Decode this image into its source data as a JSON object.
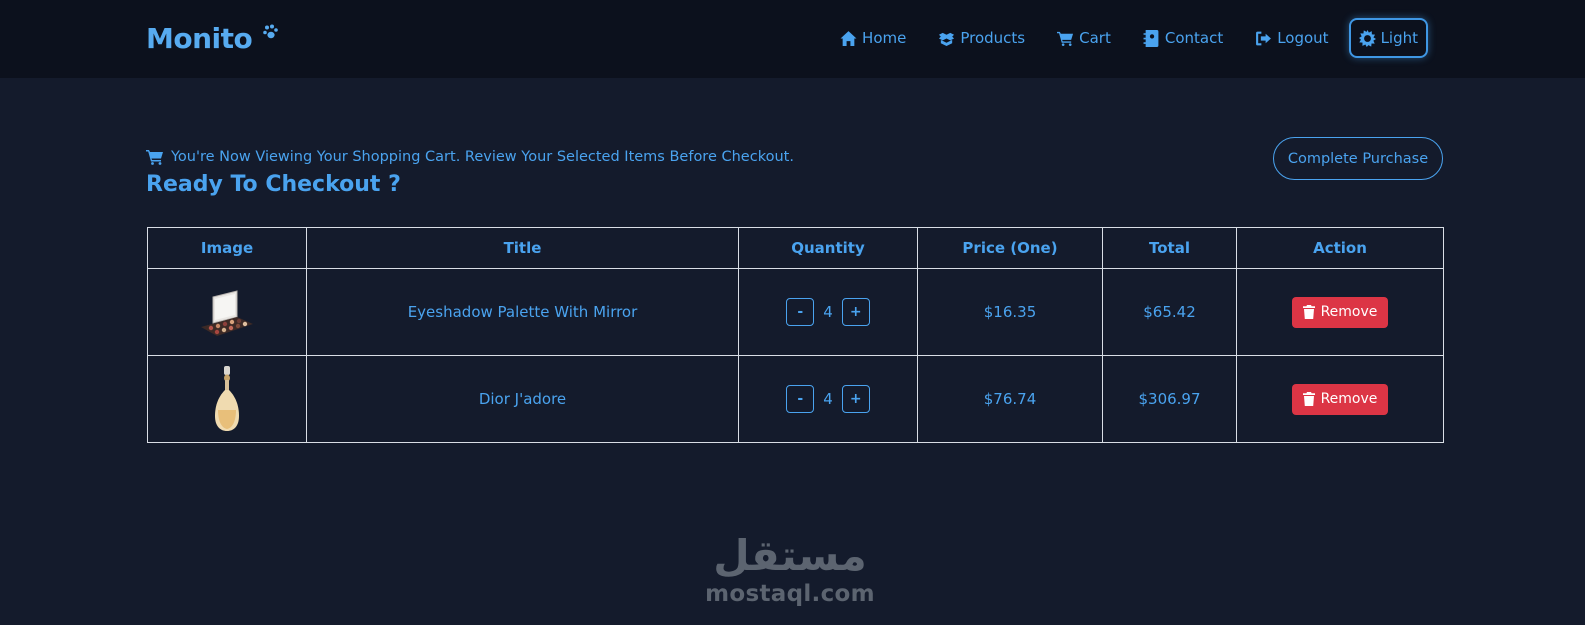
{
  "brand": {
    "name": "Monito"
  },
  "nav": {
    "items": [
      {
        "label": "Home",
        "icon": "home-icon"
      },
      {
        "label": "Products",
        "icon": "boxes-icon"
      },
      {
        "label": "Cart",
        "icon": "cart-icon"
      },
      {
        "label": "Contact",
        "icon": "address-book-icon"
      },
      {
        "label": "Logout",
        "icon": "logout-icon"
      },
      {
        "label": "Light",
        "icon": "sun-icon"
      }
    ]
  },
  "cart_header": {
    "note": "You're Now Viewing Your Shopping Cart. Review Your Selected Items Before Checkout.",
    "title": "Ready To Checkout ?",
    "complete_label": "Complete Purchase"
  },
  "table": {
    "headers": [
      "Image",
      "Title",
      "Quantity",
      "Price (One)",
      "Total",
      "Action"
    ],
    "rows": [
      {
        "image": "eyeshadow-palette-image",
        "title": "Eyeshadow Palette With Mirror",
        "quantity": "4",
        "price": "$16.35",
        "total": "$65.42",
        "action": "Remove"
      },
      {
        "image": "perfume-bottle-image",
        "title": "Dior J'adore",
        "quantity": "4",
        "price": "$76.74",
        "total": "$306.97",
        "action": "Remove"
      }
    ],
    "minus_label": "-",
    "plus_label": "+"
  },
  "watermark": {
    "arabic": "مستقل",
    "latin": "mostaql.com"
  },
  "colors": {
    "page_bg": "#141b2c",
    "navbar_bg": "#0c111d",
    "accent": "#4aa3ef",
    "danger": "#dc3545",
    "border": "#d9dee6"
  }
}
